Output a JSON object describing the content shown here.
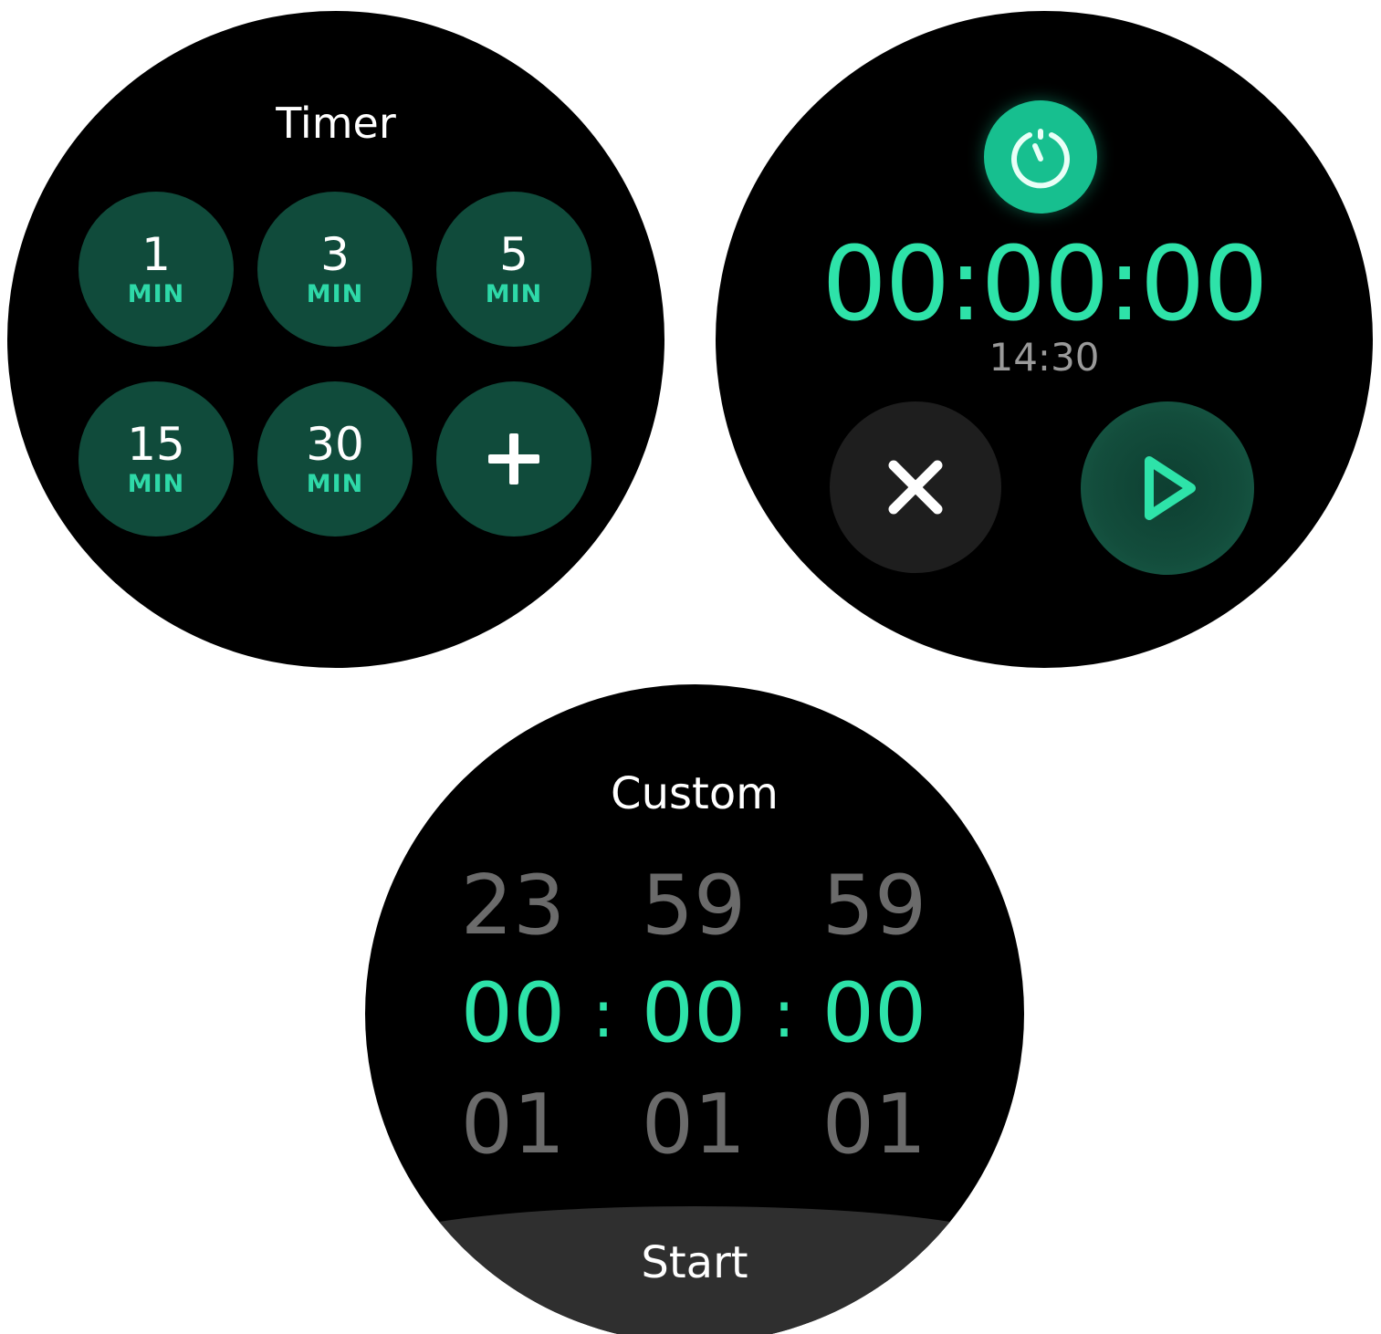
{
  "presets_screen": {
    "title": "Timer",
    "presets": [
      {
        "value": "1",
        "unit": "MIN"
      },
      {
        "value": "3",
        "unit": "MIN"
      },
      {
        "value": "5",
        "unit": "MIN"
      },
      {
        "value": "15",
        "unit": "MIN"
      },
      {
        "value": "30",
        "unit": "MIN"
      }
    ],
    "add_icon": "plus-icon"
  },
  "running_screen": {
    "badge_icon": "timer-icon",
    "time": "00:00:00",
    "clock": "14:30",
    "cancel_icon": "close-icon",
    "play_icon": "play-icon"
  },
  "custom_screen": {
    "title": "Custom",
    "previous_row": [
      "23",
      "59",
      "59"
    ],
    "selected_row": [
      "00",
      "00",
      "00"
    ],
    "separator": ":",
    "next_row": [
      "01",
      "01",
      "01"
    ],
    "start_label": "Start"
  },
  "colors": {
    "background": "#000000",
    "accent": "#2ee3a9",
    "preset_bg": "#104b3b",
    "badge": "#17bf8f",
    "muted_text": "#6b6b6b",
    "cancel_bg": "#1e1e1e",
    "start_bg": "#2f2f2f"
  }
}
